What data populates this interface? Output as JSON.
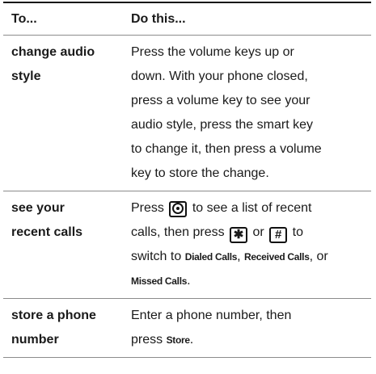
{
  "header": {
    "col1": "To...",
    "col2": "Do this..."
  },
  "rows": [
    {
      "action": "change audio style",
      "steps": [
        "Press the volume keys up or",
        "down. With your phone closed,",
        "press a volume key to see your",
        "audio style, press the smart key",
        "to change it, then press a volume",
        "key to store the change."
      ]
    },
    {
      "action_line1": "see your",
      "action_line2": "recent calls",
      "line1_pre": "Press",
      "line1_post": "to see a list of recent",
      "line2_pre": "calls, then press",
      "line2_mid": "or",
      "line2_post": "to",
      "line3_pre": "switch to",
      "dialed": "Dialed Calls",
      "received": "Received Calls",
      "line3_post": ", or",
      "missed": "Missed Calls",
      "end": ".",
      "key_star": "✱",
      "key_hash": "#"
    },
    {
      "action_line1": "store a phone",
      "action_line2": "number",
      "line1": "Enter a phone number, then",
      "line2_pre": "press",
      "store": "Store",
      "end": "."
    }
  ],
  "icons": {
    "send_key": "send-key-icon",
    "star_key": "star-key-icon",
    "hash_key": "hash-key-icon"
  }
}
